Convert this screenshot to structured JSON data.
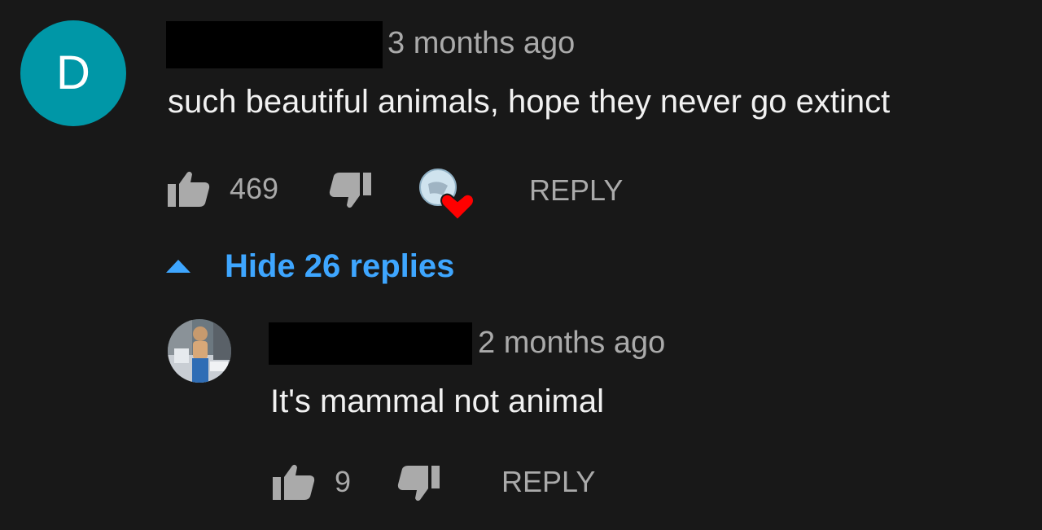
{
  "comment": {
    "avatar_letter": "D",
    "avatar_color": "#0097a7",
    "timestamp": "3 months ago",
    "text": "such beautiful animals, hope they never go extinct",
    "like_count": "469",
    "reply_label": "REPLY",
    "creator_heart": true
  },
  "replies_toggle": {
    "label": "Hide 26 replies",
    "color": "#3ea6ff"
  },
  "reply": {
    "timestamp": "2 months ago",
    "text": "It's mammal not animal",
    "like_count": "9",
    "reply_label": "REPLY"
  },
  "icons": {
    "like": "thumb-up-icon",
    "dislike": "thumb-down-icon",
    "collapse": "caret-up-icon",
    "heart": "heart-icon"
  }
}
